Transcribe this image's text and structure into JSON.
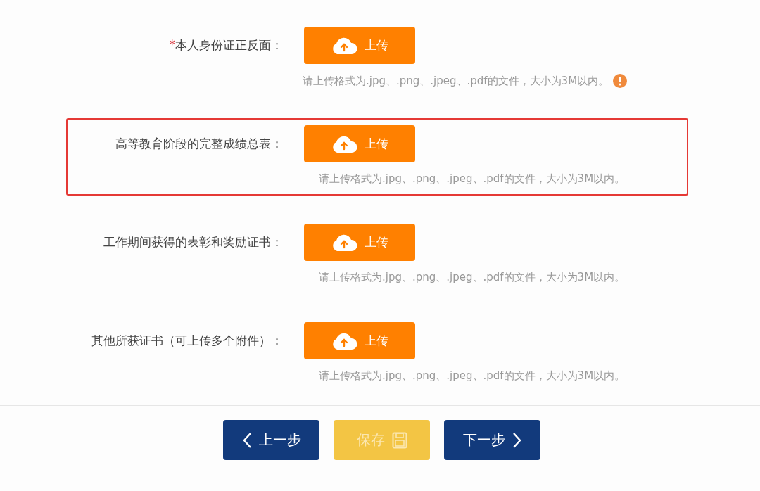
{
  "uploads": [
    {
      "required_mark": "*",
      "label": "本人身份证正反面：",
      "button": "上传",
      "hint": "请上传格式为.jpg、.png、.jpeg、.pdf的文件，大小为3M以内。",
      "warning": true,
      "highlighted": false
    },
    {
      "label": "高等教育阶段的完整成绩总表：",
      "button": "上传",
      "hint": "请上传格式为.jpg、.png、.jpeg、.pdf的文件，大小为3M以内。",
      "warning": false,
      "highlighted": true
    },
    {
      "label": "工作期间获得的表彰和奖励证书：",
      "button": "上传",
      "hint": "请上传格式为.jpg、.png、.jpeg、.pdf的文件，大小为3M以内。",
      "warning": false,
      "highlighted": false
    },
    {
      "label": "其他所获证书（可上传多个附件）：",
      "button": "上传",
      "hint": "请上传格式为.jpg、.png、.jpeg、.pdf的文件，大小为3M以内。",
      "warning": false,
      "highlighted": false
    }
  ],
  "footer_buttons": [
    {
      "kind": "prev",
      "label": "上一步"
    },
    {
      "kind": "save",
      "label": "保存"
    },
    {
      "kind": "next",
      "label": "下一步"
    }
  ]
}
